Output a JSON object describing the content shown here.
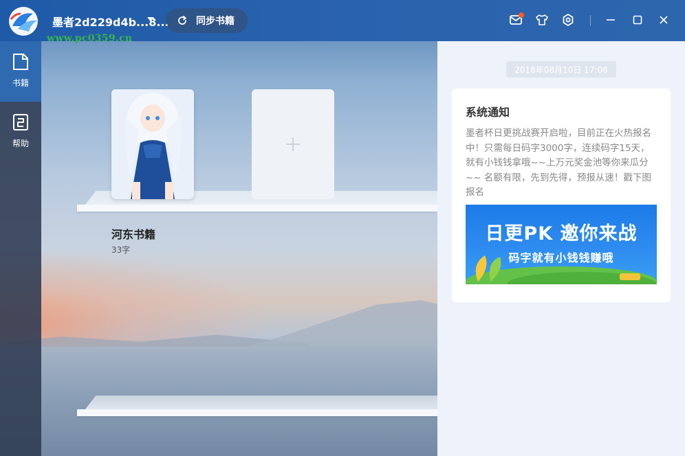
{
  "titlebar": {
    "username": "墨者2d229d4b...8...",
    "watermark_url": "www.pc0359.cn",
    "sync_label": "同步书籍"
  },
  "sidebar": {
    "items": [
      {
        "label": "书籍",
        "icon": "book-icon",
        "active": true
      },
      {
        "label": "帮助",
        "icon": "help-icon",
        "active": false
      }
    ]
  },
  "shelf": {
    "books": [
      {
        "title": "河东书籍",
        "words": "33字"
      }
    ],
    "add_icon": "plus-icon"
  },
  "notification": {
    "date": "2018年08月10日 17:08",
    "title": "系统通知",
    "body": "墨者杯日更挑战赛开启啦，目前正在火热报名中！只需每日码字3000字，连续码字15天，就有小钱钱拿哦~~上万元奖金池等你来瓜分~~ 名额有限，先到先得，预报从速！戳下图报名",
    "banner_headline": "日更PK 邀你来战",
    "banner_sub": "码字就有小钱钱赚哦"
  },
  "colors": {
    "titlebar": "#2a63ad",
    "sidebar_active": "#2f6ab0",
    "notify_dot": "#ff5a1f",
    "panel_bg": "#eef3fb"
  }
}
